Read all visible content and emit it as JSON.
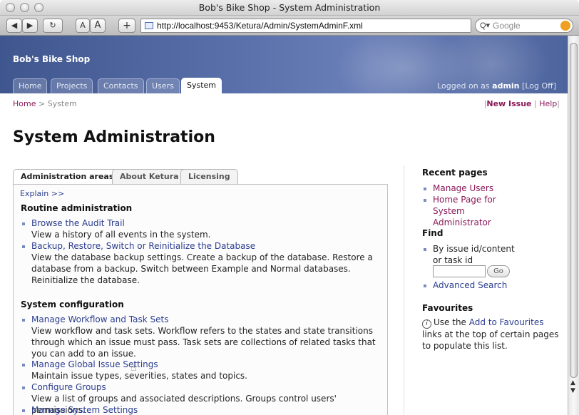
{
  "window": {
    "title": "Bob's Bike Shop - System Administration"
  },
  "toolbar": {
    "back": "◀",
    "forward": "▶",
    "reload": "↻",
    "text_small": "A",
    "text_large": "A",
    "add": "+",
    "url": "http://localhost:9453/Ketura/Admin/SystemAdminF.xml",
    "search_placeholder": "Google"
  },
  "header": {
    "shop_name": "Bob's Bike Shop",
    "tabs": [
      "Home",
      "Projects",
      "Contacts",
      "Users",
      "System"
    ],
    "active_tab": "System",
    "logged_on_prefix": "Logged on as",
    "logged_on_user": "admin",
    "logoff": "[Log Off]"
  },
  "breadcrumb": {
    "home": "Home",
    "sep": ">",
    "current": "System"
  },
  "toplinks": {
    "new_issue": "New Issue",
    "help": "Help"
  },
  "page_title": "System Administration",
  "content_tabs": [
    "Administration areas",
    "About Ketura",
    "Licensing"
  ],
  "explain": "Explain >>",
  "sections": [
    {
      "title": "Routine administration",
      "items": [
        {
          "label": "Browse the Audit Trail",
          "desc": "View a history of all events in the system."
        },
        {
          "label": "Backup, Restore, Switch or Reinitialize the Database",
          "desc": "View the database backup settings. Create a backup of the database. Restore a database from a backup. Switch between Example and Normal databases. Reinitialize the database."
        }
      ]
    },
    {
      "title": "System configuration",
      "items": [
        {
          "label": "Manage Workflow and Task Sets",
          "desc": "View workflow and task sets. Workflow refers to the states and state transitions through which an issue must pass. Task sets are collections of related tasks that you can add to an issue."
        },
        {
          "label": "Manage Global Issue Settings",
          "desc": "Maintain issue types, severities, states and topics."
        },
        {
          "label": "Configure Groups",
          "desc": "View a list of groups and associated descriptions. Groups control users' permissions."
        },
        {
          "label": "Manage System Settings",
          "desc": ""
        }
      ]
    }
  ],
  "sidebar": {
    "recent_title": "Recent pages",
    "recent": [
      "Manage Users",
      "Home Page for System Administrator"
    ],
    "find_title": "Find",
    "find_label": "By issue id/content or task id",
    "find_go": "Go",
    "advanced_search": "Advanced Search",
    "fav_title": "Favourites",
    "fav_text_pre": "Use the",
    "fav_link": "Add to Favourites",
    "fav_text_post": "links at the top of certain pages to populate this list."
  }
}
